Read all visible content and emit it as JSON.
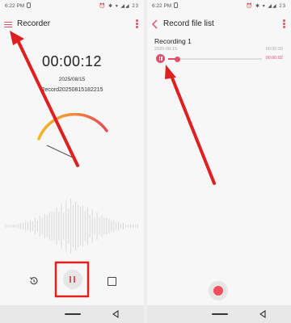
{
  "left": {
    "status": {
      "time": "6:22 PM",
      "icons": "⏰ ✱ ▾ ◢◢ 23"
    },
    "title": "Recorder",
    "timer": "00:00:12",
    "date": "2025/08/15",
    "filename": "Record20250815182215"
  },
  "right": {
    "status": {
      "time": "6:22 PM",
      "icons": "⏰ ✱ ▾ ◢◢ 23"
    },
    "title": "Record file list",
    "recording": {
      "name": "Recording 1",
      "date": "2025-08-15",
      "duration": "00:00:20",
      "current": "00:00:02",
      "progress": 0.1
    }
  },
  "colors": {
    "accent": "#e0526a",
    "annotation": "#e02020"
  },
  "icons": {
    "menu": "hamburger-icon",
    "more": "more-vert-icon",
    "back": "chevron-left-icon",
    "history": "history-icon",
    "pause": "pause-icon",
    "stop": "stop-icon",
    "record": "record-icon",
    "home": "home-pill-icon",
    "navback": "nav-back-icon"
  }
}
